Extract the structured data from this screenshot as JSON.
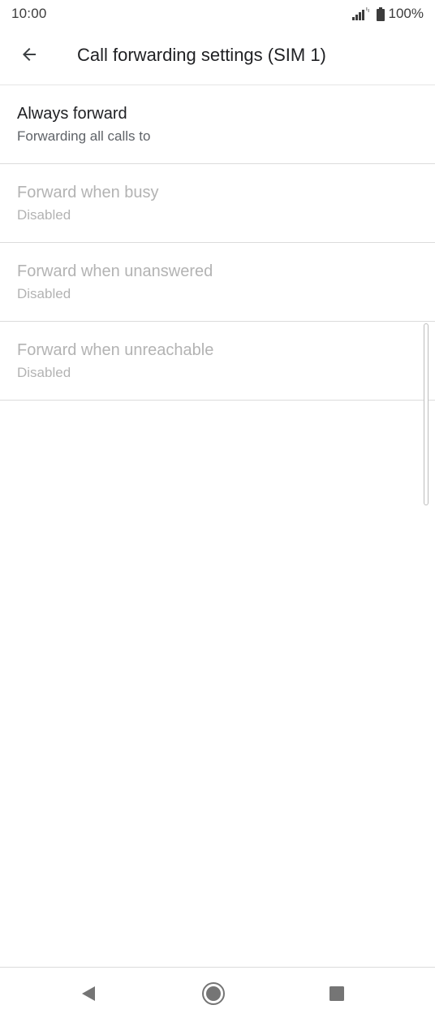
{
  "status_bar": {
    "time": "10:00",
    "battery_text": "100%",
    "icons": [
      "signal-icon",
      "battery-icon"
    ]
  },
  "app_bar": {
    "title": "Call forwarding settings (SIM 1)",
    "back_icon": "arrow-back-icon"
  },
  "items": [
    {
      "title": "Always forward",
      "summary": "Forwarding all calls to",
      "enabled": true
    },
    {
      "title": "Forward when busy",
      "summary": "Disabled",
      "enabled": false
    },
    {
      "title": "Forward when unanswered",
      "summary": "Disabled",
      "enabled": false
    },
    {
      "title": "Forward when unreachable",
      "summary": "Disabled",
      "enabled": false
    }
  ],
  "nav_bar": {
    "icons": [
      "nav-back-icon",
      "nav-home-icon",
      "nav-recents-icon"
    ]
  },
  "colors": {
    "text_primary": "#202124",
    "text_secondary": "#5f6368",
    "text_disabled": "#b3b3b3",
    "divider": "#dcdcdc"
  }
}
